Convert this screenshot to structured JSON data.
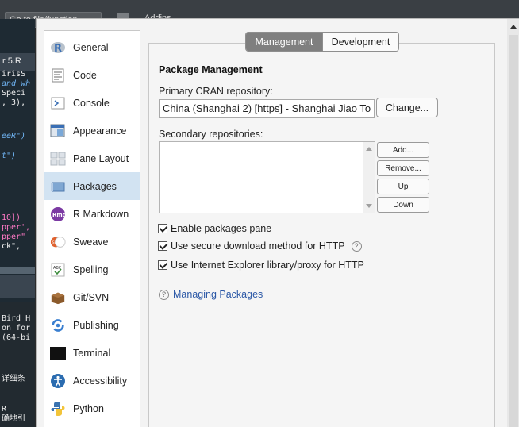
{
  "background": {
    "goto_placeholder": "Go to file/function",
    "addins_label": "Addins",
    "editor_tab": "r 5.R",
    "code_lines": [
      {
        "text": "irisS",
        "style": "white"
      },
      {
        "text": "and wh",
        "style": "blue"
      },
      {
        "text": "Speci",
        "style": "white"
      },
      {
        "text": ", 3),",
        "style": "white"
      },
      {
        "text": "eeR\")",
        "style": "blue"
      },
      {
        "text": "t\")",
        "style": "blue"
      },
      {
        "text": "10])",
        "style": "pink"
      },
      {
        "text": "pper',",
        "style": "pink"
      },
      {
        "text": "pper\"",
        "style": "pink"
      },
      {
        "text": "ck\",",
        "style": "white"
      }
    ],
    "console_lines": [
      "Bird H",
      "on for",
      "(64-bi",
      "",
      "详细条",
      "",
      "R",
      "确地引"
    ]
  },
  "sidebar": {
    "items": [
      {
        "label": "General",
        "icon": "r-logo-icon"
      },
      {
        "label": "Code",
        "icon": "code-icon"
      },
      {
        "label": "Console",
        "icon": "console-icon"
      },
      {
        "label": "Appearance",
        "icon": "appearance-icon"
      },
      {
        "label": "Pane Layout",
        "icon": "pane-layout-icon"
      },
      {
        "label": "Packages",
        "icon": "packages-icon",
        "selected": true
      },
      {
        "label": "R Markdown",
        "icon": "rmd-icon"
      },
      {
        "label": "Sweave",
        "icon": "sweave-icon"
      },
      {
        "label": "Spelling",
        "icon": "spelling-icon"
      },
      {
        "label": "Git/SVN",
        "icon": "git-svn-icon"
      },
      {
        "label": "Publishing",
        "icon": "publishing-icon"
      },
      {
        "label": "Terminal",
        "icon": "terminal-icon"
      },
      {
        "label": "Accessibility",
        "icon": "accessibility-icon"
      },
      {
        "label": "Python",
        "icon": "python-icon"
      }
    ]
  },
  "tabs": {
    "management": "Management",
    "development": "Development",
    "active": "Management"
  },
  "package_management": {
    "heading": "Package Management",
    "primary_label": "Primary CRAN repository:",
    "primary_value": "China (Shanghai 2) [https] - Shanghai Jiao To",
    "change_button": "Change...",
    "secondary_label": "Secondary repositories:",
    "secondary_items": [],
    "buttons": {
      "add": "Add...",
      "remove": "Remove...",
      "up": "Up",
      "down": "Down"
    },
    "checkboxes": [
      {
        "label": "Enable packages pane",
        "checked": true,
        "help": false
      },
      {
        "label": "Use secure download method for HTTP",
        "checked": true,
        "help": true
      },
      {
        "label": "Use Internet Explorer library/proxy for HTTP",
        "checked": true,
        "help": false
      }
    ],
    "help_glyph": "?",
    "link": "Managing Packages"
  },
  "colors": {
    "selected_nav": "#d2e3f2",
    "active_tab": "#7f7f7f",
    "link": "#2a57a6"
  }
}
